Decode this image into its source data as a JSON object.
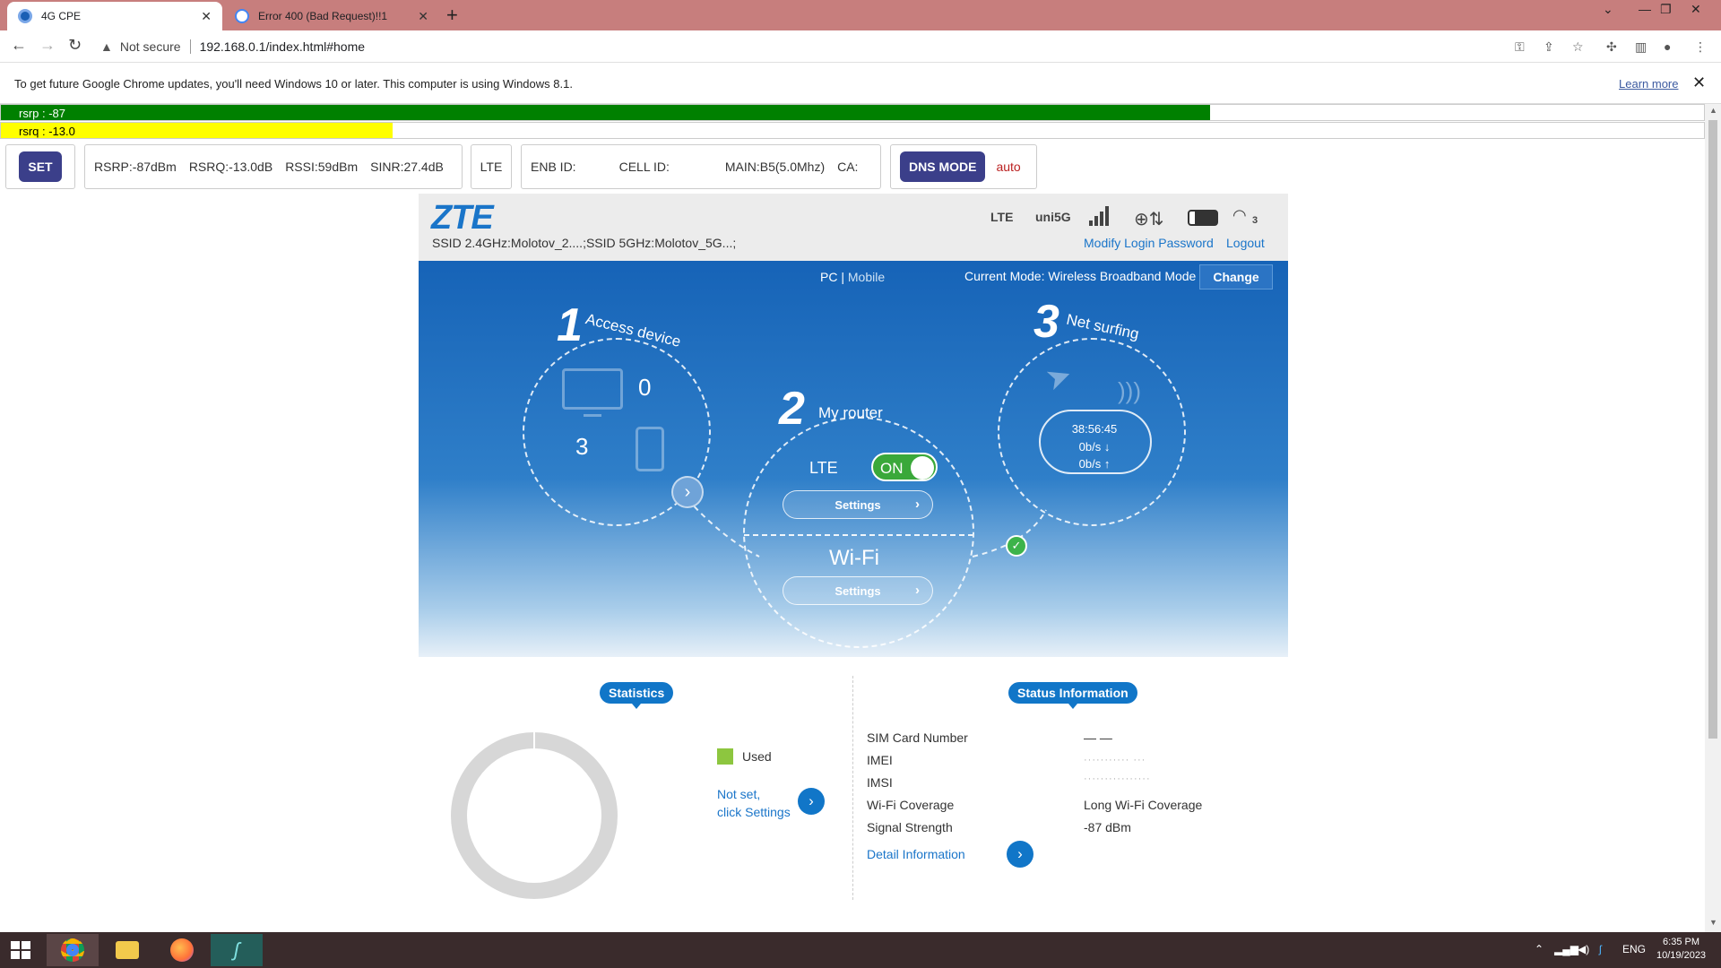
{
  "browser": {
    "tabs": [
      {
        "title": "4G CPE",
        "active": true
      },
      {
        "title": "Error 400 (Bad Request)!!1",
        "active": false
      }
    ],
    "address": {
      "security": "Not secure",
      "url": "192.168.0.1/index.html#home"
    },
    "infobar": {
      "message": "To get future Google Chrome updates, you'll need Windows 10 or later. This computer is using Windows 8.1.",
      "link": "Learn more"
    }
  },
  "signal_bars": {
    "rsrp": {
      "label": "rsrp : -87",
      "fill_fraction": 0.71,
      "color": "#008000"
    },
    "rsrq": {
      "label": "rsrq : -13.0",
      "fill_fraction": 0.23,
      "color": "#ffff00"
    }
  },
  "cell_info": {
    "set_label": "SET",
    "metrics": [
      "RSRP:-87dBm",
      "RSRQ:-13.0dB",
      "RSSI:59dBm",
      "SINR:27.4dB"
    ],
    "network": "LTE",
    "ids": [
      "ENB ID:",
      "CELL ID:",
      "MAIN:B5(5.0Mhz)",
      "CA:"
    ],
    "dns_label": "DNS MODE",
    "dns_value": "auto"
  },
  "router": {
    "brand": "ZTE",
    "ssid": "SSID 2.4GHz:Molotov_2....;SSID 5GHz:Molotov_5G...;",
    "network_type": "LTE",
    "operator": "uni5G",
    "wifi_clients": "3",
    "links": {
      "modify_password": "Modify Login Password",
      "logout": "Logout"
    },
    "view": {
      "pc": "PC",
      "separator": "|",
      "mobile": "Mobile"
    },
    "current_mode": "Current Mode: Wireless Broadband Mode",
    "change_label": "Change",
    "step1": {
      "number": "1",
      "title": "Access device",
      "wired_count": "0",
      "wireless_count": "3"
    },
    "step2": {
      "number": "2",
      "title": "My router",
      "lte_label": "LTE",
      "toggle": "ON",
      "settings_label": "Settings",
      "wifi_label": "Wi-Fi",
      "wifi_settings_label": "Settings"
    },
    "step3": {
      "number": "3",
      "title": "Net surfing",
      "duration": "38:56:45",
      "down": "0b/s ↓",
      "up": "0b/s ↑"
    }
  },
  "statistics": {
    "title": "Statistics",
    "legend_used": "Used",
    "not_set_line1": "Not set,",
    "not_set_line2": "click Settings",
    "used_fraction": 0.0
  },
  "status_info": {
    "title": "Status Information",
    "rows": [
      {
        "label": "SIM Card Number",
        "value": "— —"
      },
      {
        "label": "IMEI",
        "value": "···········  ···"
      },
      {
        "label": "IMSI",
        "value": "················"
      },
      {
        "label": "Wi-Fi Coverage",
        "value": "Long Wi-Fi Coverage"
      },
      {
        "label": "Signal Strength",
        "value": "-87 dBm"
      }
    ],
    "detail_link": "Detail Information"
  },
  "taskbar": {
    "language": "ENG",
    "time": "6:35 PM",
    "date": "10/19/2023"
  }
}
